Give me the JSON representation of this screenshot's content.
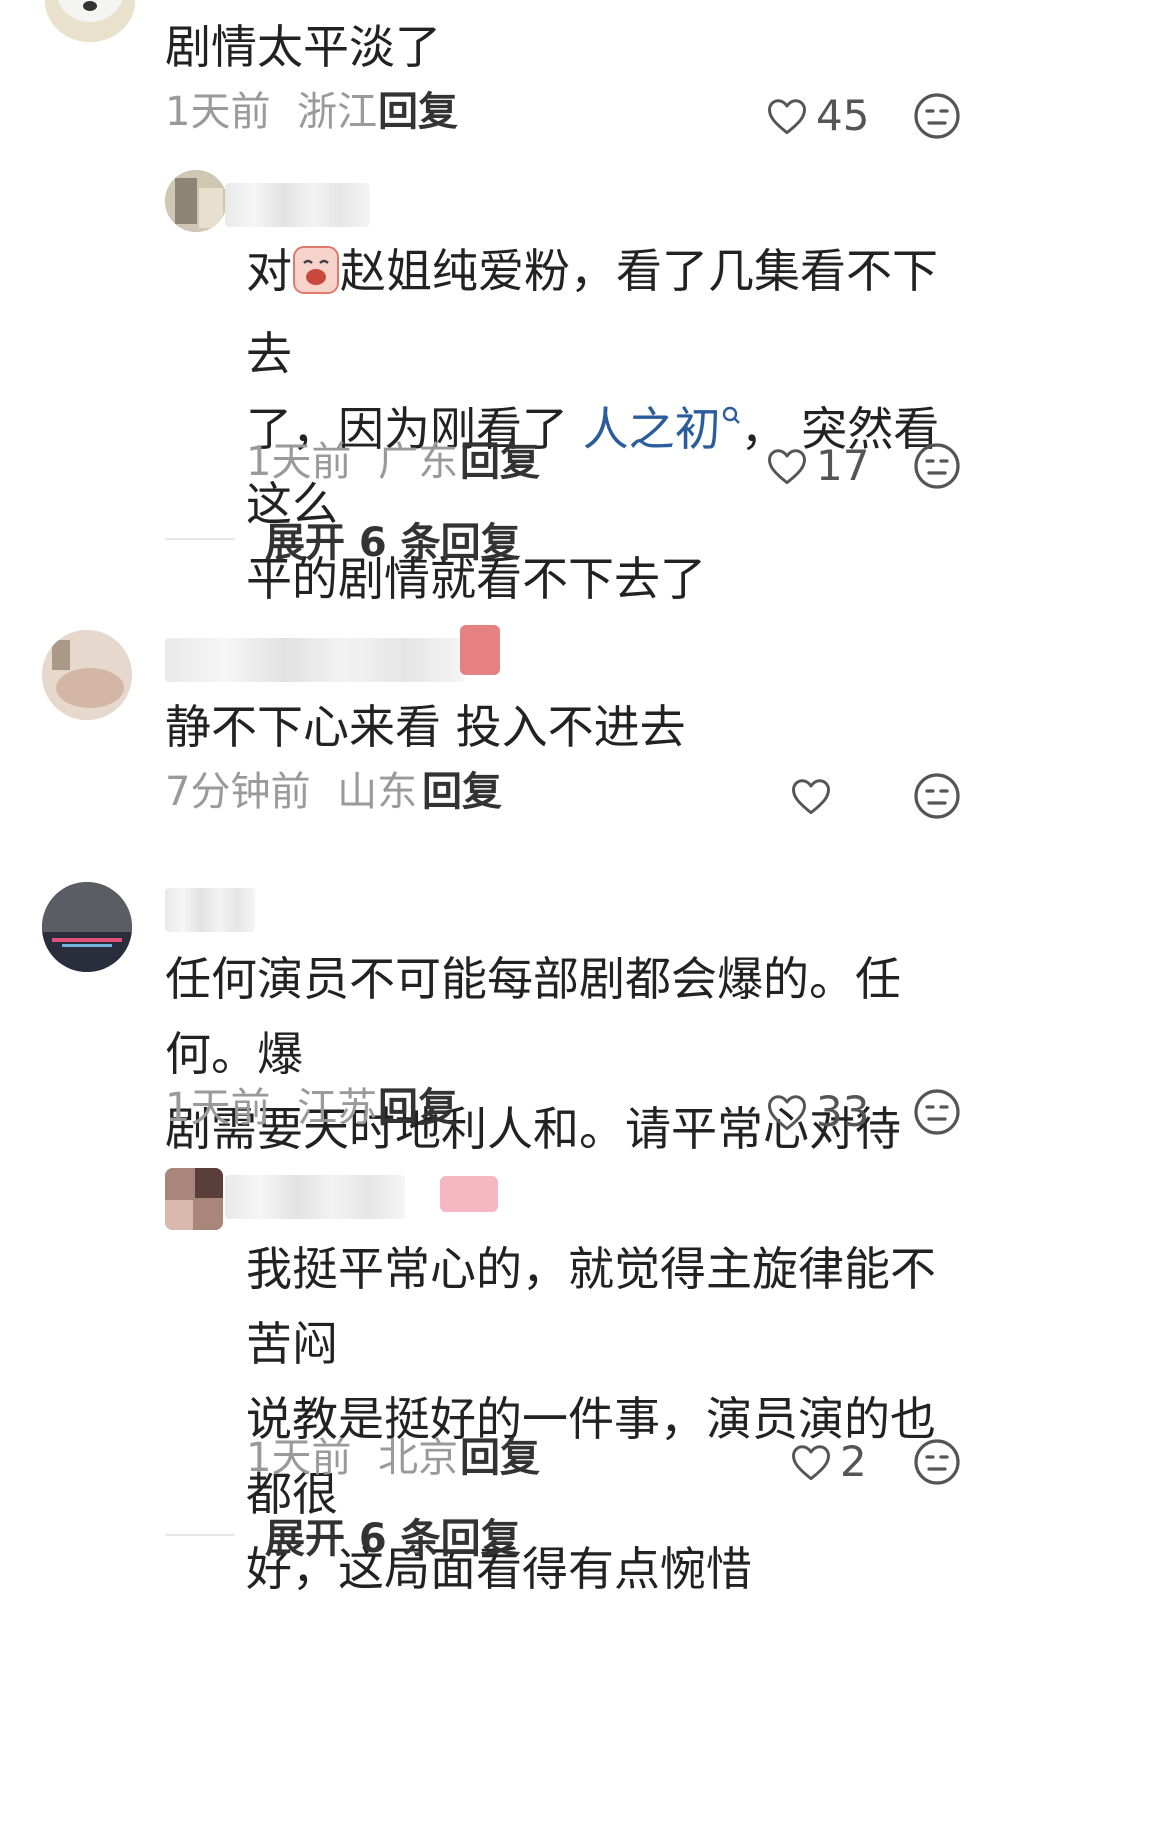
{
  "comments": [
    {
      "text": "剧情太平淡了",
      "time": "1天前",
      "location": "浙江",
      "reply_label": "回复",
      "likes": "45",
      "replies": [
        {
          "text_before_emoji": "对",
          "text_after_emoji": "赵姐纯爱粉，看了几集看不下去",
          "line2_before_link": "了，因为刚看了 ",
          "link_text": "人之初",
          "line2_after_link": "， 突然看这么",
          "line3": "平的剧情就看不下去了",
          "time": "1天前",
          "location": "广东",
          "reply_label": "回复",
          "likes": "17"
        }
      ],
      "expand_label": "展开 6 条回复"
    },
    {
      "text": "静不下心来看 投入不进去",
      "time": "7分钟前",
      "location": "山东",
      "reply_label": "回复",
      "likes": ""
    },
    {
      "line1": "任何演员不可能每部剧都会爆的。任何。爆",
      "line2": "剧需要天时地利人和。请平常心对待",
      "time": "1天前",
      "location": "江苏",
      "reply_label": "回复",
      "likes": "33",
      "replies": [
        {
          "line1": "我挺平常心的，就觉得主旋律能不苦闷",
          "line2": "说教是挺好的一件事，演员演的也都很",
          "line3": "好，这局面看得有点惋惜",
          "time": "1天前",
          "location": "北京",
          "reply_label": "回复",
          "likes": "2"
        }
      ],
      "expand_label": "展开 6 条回复"
    }
  ],
  "icons": {
    "like": "heart-outline-icon",
    "dislike": "meh-face-icon",
    "search": "search-link-icon"
  },
  "colors": {
    "link": "#2b5d9c",
    "meta": "#9a9a9a"
  }
}
